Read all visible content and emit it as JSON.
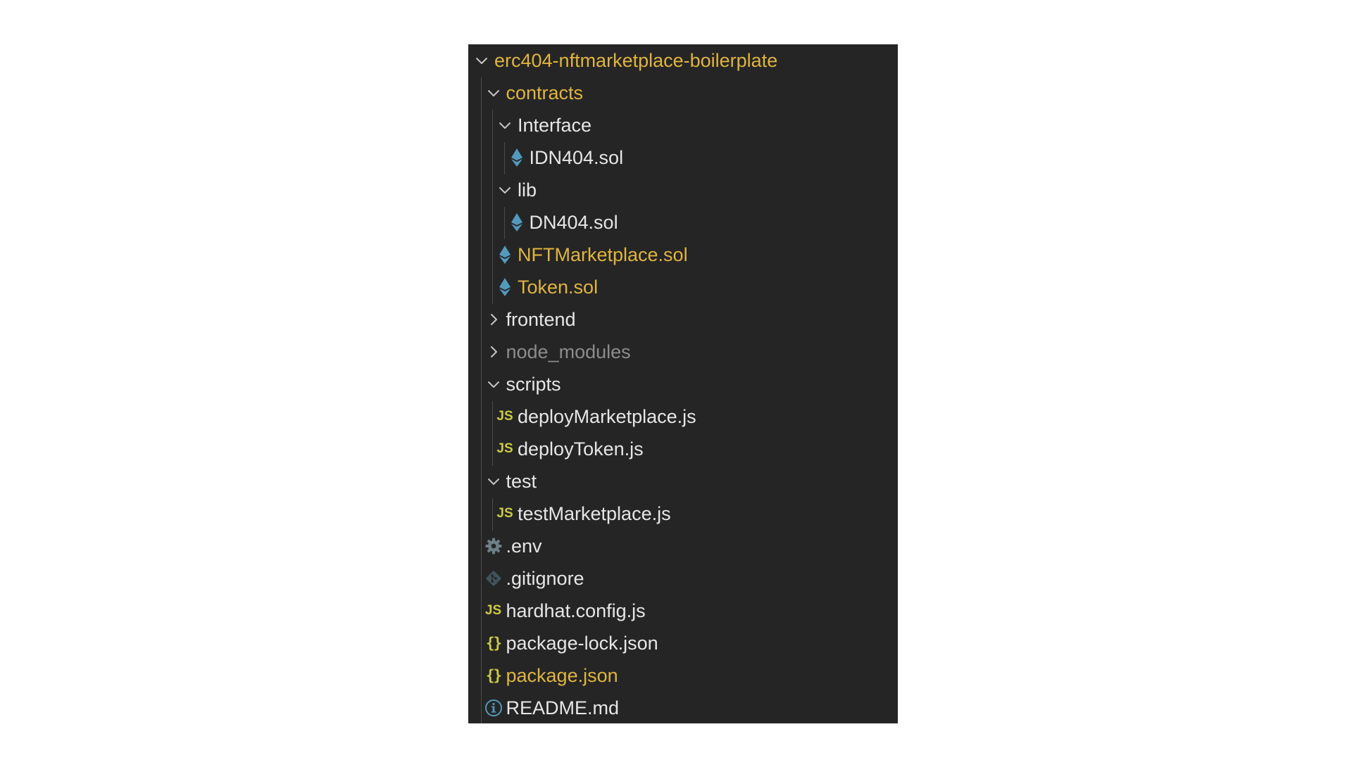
{
  "explorer": {
    "items": [
      {
        "label": "erc404-nftmarketplace-boilerplate",
        "kind": "folder",
        "expanded": true,
        "depth": 0,
        "modified": true,
        "icon": "chevron-down-icon"
      },
      {
        "label": "contracts",
        "kind": "folder",
        "expanded": true,
        "depth": 1,
        "modified": true,
        "icon": "chevron-down-icon"
      },
      {
        "label": "Interface",
        "kind": "folder",
        "expanded": true,
        "depth": 2,
        "icon": "chevron-down-icon"
      },
      {
        "label": "IDN404.sol",
        "kind": "file",
        "depth": 3,
        "icon": "ethereum-icon"
      },
      {
        "label": "lib",
        "kind": "folder",
        "expanded": true,
        "depth": 2,
        "icon": "chevron-down-icon"
      },
      {
        "label": "DN404.sol",
        "kind": "file",
        "depth": 3,
        "icon": "ethereum-icon"
      },
      {
        "label": "NFTMarketplace.sol",
        "kind": "file",
        "depth": 2,
        "modified": true,
        "icon": "ethereum-icon"
      },
      {
        "label": "Token.sol",
        "kind": "file",
        "depth": 2,
        "modified": true,
        "icon": "ethereum-icon"
      },
      {
        "label": "frontend",
        "kind": "folder",
        "expanded": false,
        "depth": 1,
        "icon": "chevron-right-icon"
      },
      {
        "label": "node_modules",
        "kind": "folder",
        "expanded": false,
        "depth": 1,
        "dim": true,
        "icon": "chevron-right-icon"
      },
      {
        "label": "scripts",
        "kind": "folder",
        "expanded": true,
        "depth": 1,
        "icon": "chevron-down-icon"
      },
      {
        "label": "deployMarketplace.js",
        "kind": "file",
        "depth": 2,
        "icon": "javascript-icon",
        "icon_text": "JS"
      },
      {
        "label": "deployToken.js",
        "kind": "file",
        "depth": 2,
        "icon": "javascript-icon",
        "icon_text": "JS"
      },
      {
        "label": "test",
        "kind": "folder",
        "expanded": true,
        "depth": 1,
        "icon": "chevron-down-icon"
      },
      {
        "label": "testMarketplace.js",
        "kind": "file",
        "depth": 2,
        "icon": "javascript-icon",
        "icon_text": "JS"
      },
      {
        "label": ".env",
        "kind": "file",
        "depth": 1,
        "icon": "gear-icon"
      },
      {
        "label": ".gitignore",
        "kind": "file",
        "depth": 1,
        "icon": "git-icon"
      },
      {
        "label": "hardhat.config.js",
        "kind": "file",
        "depth": 1,
        "icon": "javascript-icon",
        "icon_text": "JS"
      },
      {
        "label": "package-lock.json",
        "kind": "file",
        "depth": 1,
        "icon": "json-icon",
        "icon_text": "{}"
      },
      {
        "label": "package.json",
        "kind": "file",
        "depth": 1,
        "modified": true,
        "icon": "json-icon",
        "icon_text": "{}"
      },
      {
        "label": "README.md",
        "kind": "file",
        "depth": 1,
        "icon": "info-icon"
      }
    ]
  },
  "colors": {
    "background": "#252526",
    "text": "#e6e6e6",
    "modified": "#e0b53c",
    "dim": "#8c8c8c",
    "ethereum": "#519aba",
    "javascript": "#cbcb41",
    "json": "#cbcb41",
    "gear": "#6d8086",
    "git": "#41535b",
    "info": "#519aba"
  }
}
